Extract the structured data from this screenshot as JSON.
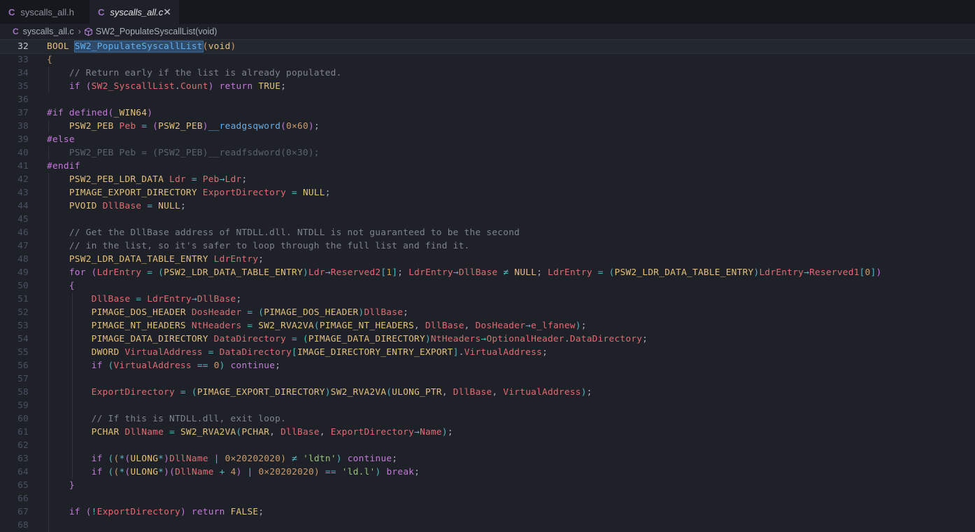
{
  "tabs": [
    {
      "icon": "C",
      "label": "syscalls_all.h",
      "active": false
    },
    {
      "icon": "C",
      "label": "syscalls_all.c",
      "active": true,
      "close": "✕"
    }
  ],
  "breadcrumb": {
    "file_icon": "C",
    "file": "syscalls_all.c",
    "separator": "›",
    "symbol_icon": "cube-icon",
    "symbol": "SW2_PopulateSyscallList(void)"
  },
  "colors": {
    "keyword": "#c678dd",
    "type": "#e5c07b",
    "variable": "#e06c75",
    "function": "#61afef",
    "string": "#98c379",
    "number": "#d19a66",
    "comment": "#7f848e",
    "operator": "#56b6c2",
    "text": "#abb2bf",
    "bracket1": "#d19a66",
    "bracket2": "#c678dd",
    "bracket3": "#56b6c2"
  },
  "current_line": 32,
  "lines": [
    {
      "n": "32",
      "indent": 0,
      "t": [
        [
          "BOOL ",
          "ty"
        ],
        [
          "SW2_PopulateSyscallList",
          "fnhl"
        ],
        [
          "(",
          "b1"
        ],
        [
          "void",
          "ty"
        ],
        [
          ")",
          "b1"
        ]
      ]
    },
    {
      "n": "33",
      "indent": 0,
      "t": [
        [
          "{",
          "b1"
        ]
      ]
    },
    {
      "n": "34",
      "indent": 1,
      "t": [
        [
          "    // Return early if the list is already populated.",
          "cm"
        ]
      ]
    },
    {
      "n": "35",
      "indent": 1,
      "t": [
        [
          "    ",
          ""
        ],
        [
          "if ",
          "kw"
        ],
        [
          "(",
          "b2"
        ],
        [
          "SW2_SyscallList",
          "va"
        ],
        [
          ".",
          "tx"
        ],
        [
          "Count",
          "va"
        ],
        [
          ")",
          "b2"
        ],
        [
          " return ",
          "kw"
        ],
        [
          "TRUE",
          "ty"
        ],
        [
          ";",
          "tx"
        ]
      ]
    },
    {
      "n": "36",
      "indent": 0,
      "t": []
    },
    {
      "n": "37",
      "indent": 0,
      "t": [
        [
          "#if ",
          "kw"
        ],
        [
          "defined",
          "kw"
        ],
        [
          "(",
          "b2"
        ],
        [
          "_WIN64",
          "ty"
        ],
        [
          ")",
          "b2"
        ]
      ]
    },
    {
      "n": "38",
      "indent": 1,
      "t": [
        [
          "    ",
          ""
        ],
        [
          "PSW2_PEB ",
          "ty"
        ],
        [
          "Peb",
          "va"
        ],
        [
          " = ",
          "op"
        ],
        [
          "(",
          "b2"
        ],
        [
          "PSW2_PEB",
          "ty"
        ],
        [
          ")",
          "b2"
        ],
        [
          "__readgsqword",
          "fn"
        ],
        [
          "(",
          "b2"
        ],
        [
          "0×60",
          "nu"
        ],
        [
          ")",
          "b2"
        ],
        [
          ";",
          "tx"
        ]
      ]
    },
    {
      "n": "39",
      "indent": 0,
      "t": [
        [
          "#else",
          "kw"
        ]
      ]
    },
    {
      "n": "40",
      "indent": 1,
      "dim": true,
      "t": [
        [
          "    PSW2_PEB Peb = (PSW2_PEB)__readfsdword(0×30);",
          "dim"
        ]
      ]
    },
    {
      "n": "41",
      "indent": 0,
      "t": [
        [
          "#endif",
          "kw"
        ]
      ]
    },
    {
      "n": "42",
      "indent": 1,
      "t": [
        [
          "    ",
          ""
        ],
        [
          "PSW2_PEB_LDR_DATA ",
          "ty"
        ],
        [
          "Ldr",
          "va"
        ],
        [
          " = ",
          "op"
        ],
        [
          "Peb",
          "va"
        ],
        [
          "→",
          "op"
        ],
        [
          "Ldr",
          "va"
        ],
        [
          ";",
          "tx"
        ]
      ]
    },
    {
      "n": "43",
      "indent": 1,
      "t": [
        [
          "    ",
          ""
        ],
        [
          "PIMAGE_EXPORT_DIRECTORY ",
          "ty"
        ],
        [
          "ExportDirectory",
          "va"
        ],
        [
          " = ",
          "op"
        ],
        [
          "NULL",
          "ty"
        ],
        [
          ";",
          "tx"
        ]
      ]
    },
    {
      "n": "44",
      "indent": 1,
      "t": [
        [
          "    ",
          ""
        ],
        [
          "PVOID ",
          "ty"
        ],
        [
          "DllBase",
          "va"
        ],
        [
          " = ",
          "op"
        ],
        [
          "NULL",
          "ty"
        ],
        [
          ";",
          "tx"
        ]
      ]
    },
    {
      "n": "45",
      "indent": 1,
      "t": []
    },
    {
      "n": "46",
      "indent": 1,
      "t": [
        [
          "    // Get the DllBase address of NTDLL.dll. NTDLL is not guaranteed to be the second",
          "cm"
        ]
      ]
    },
    {
      "n": "47",
      "indent": 1,
      "t": [
        [
          "    // in the list, so it's safer to loop through the full list and find it.",
          "cm"
        ]
      ]
    },
    {
      "n": "48",
      "indent": 1,
      "t": [
        [
          "    ",
          ""
        ],
        [
          "PSW2_LDR_DATA_TABLE_ENTRY ",
          "ty"
        ],
        [
          "LdrEntry",
          "va"
        ],
        [
          ";",
          "tx"
        ]
      ]
    },
    {
      "n": "49",
      "indent": 1,
      "t": [
        [
          "    ",
          ""
        ],
        [
          "for ",
          "kw"
        ],
        [
          "(",
          "b2"
        ],
        [
          "LdrEntry",
          "va"
        ],
        [
          " = ",
          "op"
        ],
        [
          "(",
          "b3"
        ],
        [
          "PSW2_LDR_DATA_TABLE_ENTRY",
          "ty"
        ],
        [
          ")",
          "b3"
        ],
        [
          "Ldr",
          "va"
        ],
        [
          "→",
          "op"
        ],
        [
          "Reserved2",
          "va"
        ],
        [
          "[",
          "b3"
        ],
        [
          "1",
          "nu"
        ],
        [
          "]",
          "b3"
        ],
        [
          "; ",
          "tx"
        ],
        [
          "LdrEntry",
          "va"
        ],
        [
          "→",
          "op"
        ],
        [
          "DllBase",
          "va"
        ],
        [
          " ≠ ",
          "op"
        ],
        [
          "NULL",
          "ty"
        ],
        [
          "; ",
          "tx"
        ],
        [
          "LdrEntry",
          "va"
        ],
        [
          " = ",
          "op"
        ],
        [
          "(",
          "b3"
        ],
        [
          "PSW2_LDR_DATA_TABLE_ENTRY",
          "ty"
        ],
        [
          ")",
          "b3"
        ],
        [
          "LdrEntry",
          "va"
        ],
        [
          "→",
          "op"
        ],
        [
          "Reserved1",
          "va"
        ],
        [
          "[",
          "b3"
        ],
        [
          "0",
          "nu"
        ],
        [
          "]",
          "b3"
        ],
        [
          ")",
          "b2"
        ]
      ]
    },
    {
      "n": "50",
      "indent": 1,
      "t": [
        [
          "    ",
          ""
        ],
        [
          "{",
          "b2"
        ]
      ]
    },
    {
      "n": "51",
      "indent": 2,
      "t": [
        [
          "        ",
          ""
        ],
        [
          "DllBase",
          "va"
        ],
        [
          " = ",
          "op"
        ],
        [
          "LdrEntry",
          "va"
        ],
        [
          "→",
          "op"
        ],
        [
          "DllBase",
          "va"
        ],
        [
          ";",
          "tx"
        ]
      ]
    },
    {
      "n": "52",
      "indent": 2,
      "t": [
        [
          "        ",
          ""
        ],
        [
          "PIMAGE_DOS_HEADER ",
          "ty"
        ],
        [
          "DosHeader",
          "va"
        ],
        [
          " = ",
          "op"
        ],
        [
          "(",
          "b3"
        ],
        [
          "PIMAGE_DOS_HEADER",
          "ty"
        ],
        [
          ")",
          "b3"
        ],
        [
          "DllBase",
          "va"
        ],
        [
          ";",
          "tx"
        ]
      ]
    },
    {
      "n": "53",
      "indent": 2,
      "t": [
        [
          "        ",
          ""
        ],
        [
          "PIMAGE_NT_HEADERS ",
          "ty"
        ],
        [
          "NtHeaders",
          "va"
        ],
        [
          " = ",
          "op"
        ],
        [
          "SW2_RVA2VA",
          "ty"
        ],
        [
          "(",
          "b3"
        ],
        [
          "PIMAGE_NT_HEADERS",
          "ty"
        ],
        [
          ", ",
          "tx"
        ],
        [
          "DllBase",
          "va"
        ],
        [
          ", ",
          "tx"
        ],
        [
          "DosHeader",
          "va"
        ],
        [
          "→",
          "op"
        ],
        [
          "e_lfanew",
          "va"
        ],
        [
          ")",
          "b3"
        ],
        [
          ";",
          "tx"
        ]
      ]
    },
    {
      "n": "54",
      "indent": 2,
      "t": [
        [
          "        ",
          ""
        ],
        [
          "PIMAGE_DATA_DIRECTORY ",
          "ty"
        ],
        [
          "DataDirectory",
          "va"
        ],
        [
          " = ",
          "op"
        ],
        [
          "(",
          "b3"
        ],
        [
          "PIMAGE_DATA_DIRECTORY",
          "ty"
        ],
        [
          ")",
          "b3"
        ],
        [
          "NtHeaders",
          "va"
        ],
        [
          "→",
          "op"
        ],
        [
          "OptionalHeader",
          "va"
        ],
        [
          ".",
          "tx"
        ],
        [
          "DataDirectory",
          "va"
        ],
        [
          ";",
          "tx"
        ]
      ]
    },
    {
      "n": "55",
      "indent": 2,
      "t": [
        [
          "        ",
          ""
        ],
        [
          "DWORD ",
          "ty"
        ],
        [
          "VirtualAddress",
          "va"
        ],
        [
          " = ",
          "op"
        ],
        [
          "DataDirectory",
          "va"
        ],
        [
          "[",
          "b3"
        ],
        [
          "IMAGE_DIRECTORY_ENTRY_EXPORT",
          "ty"
        ],
        [
          "]",
          "b3"
        ],
        [
          ".",
          "tx"
        ],
        [
          "VirtualAddress",
          "va"
        ],
        [
          ";",
          "tx"
        ]
      ]
    },
    {
      "n": "56",
      "indent": 2,
      "t": [
        [
          "        ",
          ""
        ],
        [
          "if ",
          "kw"
        ],
        [
          "(",
          "b3"
        ],
        [
          "VirtualAddress",
          "va"
        ],
        [
          " == ",
          "op"
        ],
        [
          "0",
          "nu"
        ],
        [
          ")",
          "b3"
        ],
        [
          " continue",
          "kw"
        ],
        [
          ";",
          "tx"
        ]
      ]
    },
    {
      "n": "57",
      "indent": 2,
      "t": []
    },
    {
      "n": "58",
      "indent": 2,
      "t": [
        [
          "        ",
          ""
        ],
        [
          "ExportDirectory",
          "va"
        ],
        [
          " = ",
          "op"
        ],
        [
          "(",
          "b3"
        ],
        [
          "PIMAGE_EXPORT_DIRECTORY",
          "ty"
        ],
        [
          ")",
          "b3"
        ],
        [
          "SW2_RVA2VA",
          "ty"
        ],
        [
          "(",
          "b3"
        ],
        [
          "ULONG_PTR",
          "ty"
        ],
        [
          ", ",
          "tx"
        ],
        [
          "DllBase",
          "va"
        ],
        [
          ", ",
          "tx"
        ],
        [
          "VirtualAddress",
          "va"
        ],
        [
          ")",
          "b3"
        ],
        [
          ";",
          "tx"
        ]
      ]
    },
    {
      "n": "59",
      "indent": 2,
      "t": []
    },
    {
      "n": "60",
      "indent": 2,
      "t": [
        [
          "        // If this is NTDLL.dll, exit loop.",
          "cm"
        ]
      ]
    },
    {
      "n": "61",
      "indent": 2,
      "t": [
        [
          "        ",
          ""
        ],
        [
          "PCHAR ",
          "ty"
        ],
        [
          "DllName",
          "va"
        ],
        [
          " = ",
          "op"
        ],
        [
          "SW2_RVA2VA",
          "ty"
        ],
        [
          "(",
          "b3"
        ],
        [
          "PCHAR",
          "ty"
        ],
        [
          ", ",
          "tx"
        ],
        [
          "DllBase",
          "va"
        ],
        [
          ", ",
          "tx"
        ],
        [
          "ExportDirectory",
          "va"
        ],
        [
          "→",
          "op"
        ],
        [
          "Name",
          "va"
        ],
        [
          ")",
          "b3"
        ],
        [
          ";",
          "tx"
        ]
      ]
    },
    {
      "n": "62",
      "indent": 2,
      "t": []
    },
    {
      "n": "63",
      "indent": 2,
      "t": [
        [
          "        ",
          ""
        ],
        [
          "if ",
          "kw"
        ],
        [
          "(",
          "b3"
        ],
        [
          "(",
          "b1"
        ],
        [
          "*",
          "op"
        ],
        [
          "(",
          "b2"
        ],
        [
          "ULONG",
          "ty"
        ],
        [
          "*",
          "op"
        ],
        [
          ")",
          "b2"
        ],
        [
          "DllName",
          "va"
        ],
        [
          " | ",
          "op"
        ],
        [
          "0×20202020",
          "nu"
        ],
        [
          ")",
          "b1"
        ],
        [
          " ≠ ",
          "op"
        ],
        [
          "'ldtn'",
          "st"
        ],
        [
          ")",
          "b3"
        ],
        [
          " continue",
          "kw"
        ],
        [
          ";",
          "tx"
        ]
      ]
    },
    {
      "n": "64",
      "indent": 2,
      "t": [
        [
          "        ",
          ""
        ],
        [
          "if ",
          "kw"
        ],
        [
          "(",
          "b3"
        ],
        [
          "(",
          "b1"
        ],
        [
          "*",
          "op"
        ],
        [
          "(",
          "b2"
        ],
        [
          "ULONG",
          "ty"
        ],
        [
          "*",
          "op"
        ],
        [
          ")",
          "b2"
        ],
        [
          "(",
          "b2"
        ],
        [
          "DllName",
          "va"
        ],
        [
          " + ",
          "op"
        ],
        [
          "4",
          "nu"
        ],
        [
          ")",
          "b2"
        ],
        [
          " | ",
          "op"
        ],
        [
          "0×20202020",
          "nu"
        ],
        [
          ")",
          "b1"
        ],
        [
          " == ",
          "op"
        ],
        [
          "'ld.l'",
          "st"
        ],
        [
          ")",
          "b3"
        ],
        [
          " break",
          "kw"
        ],
        [
          ";",
          "tx"
        ]
      ]
    },
    {
      "n": "65",
      "indent": 1,
      "t": [
        [
          "    ",
          ""
        ],
        [
          "}",
          "b2"
        ]
      ]
    },
    {
      "n": "66",
      "indent": 1,
      "t": []
    },
    {
      "n": "67",
      "indent": 1,
      "t": [
        [
          "    ",
          ""
        ],
        [
          "if ",
          "kw"
        ],
        [
          "(",
          "b2"
        ],
        [
          "!",
          "op"
        ],
        [
          "ExportDirectory",
          "va"
        ],
        [
          ")",
          "b2"
        ],
        [
          " return ",
          "kw"
        ],
        [
          "FALSE",
          "ty"
        ],
        [
          ";",
          "tx"
        ]
      ]
    },
    {
      "n": "68",
      "indent": 1,
      "t": []
    }
  ]
}
